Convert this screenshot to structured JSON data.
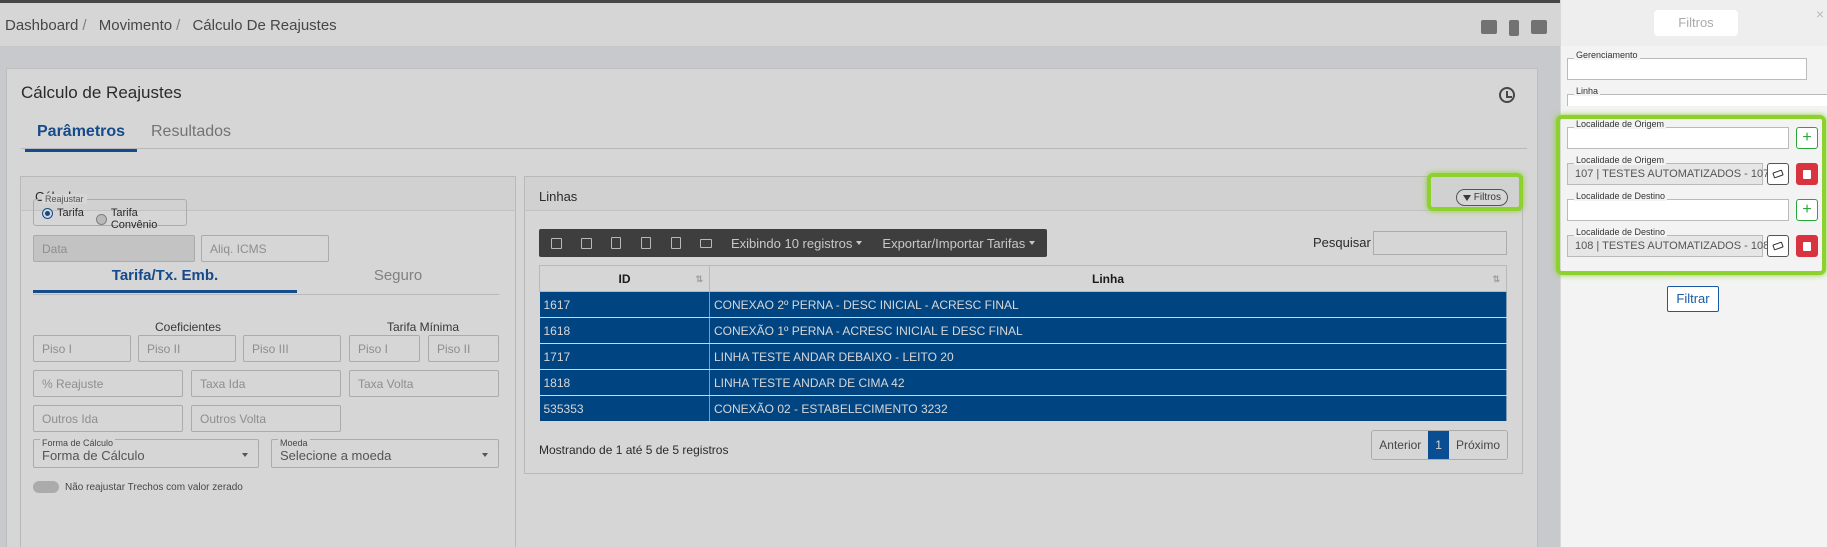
{
  "breadcrumb": [
    "Dashboard",
    "Movimento",
    "Cálculo De Reajustes"
  ],
  "page": {
    "title": "Cálculo de Reajustes",
    "tabs": [
      "Parâmetros",
      "Resultados"
    ]
  },
  "calculos": {
    "title": "Cálculos",
    "reajustar_legend": "Reajustar",
    "radio_tarifa": "Tarifa",
    "radio_tarifa_convenio": "Tarifa Convênio",
    "data_placeholder": "Data",
    "aliq_placeholder": "Aliq. ICMS",
    "subtabs": [
      "Tarifa/Tx. Emb.",
      "Seguro"
    ],
    "coeficientes_label": "Coeficientes",
    "tarifa_minima_label": "Tarifa Mínima",
    "piso_row": [
      "Piso I",
      "Piso II",
      "Piso III",
      "Piso I",
      "Piso II"
    ],
    "reajuste_placeholder": "% Reajuste",
    "taxa_ida_placeholder": "Taxa Ida",
    "taxa_volta_placeholder": "Taxa Volta",
    "outros_ida_placeholder": "Outros Ida",
    "outros_volta_placeholder": "Outros Volta",
    "forma_calculo_caption": "Forma de Cálculo",
    "forma_calculo_value": "Forma de Cálculo",
    "moeda_caption": "Moeda",
    "moeda_value": "Selecione a moeda",
    "toggle_text": "Não reajustar Trechos com valor zerado"
  },
  "linhas": {
    "title": "Linhas",
    "filtros_label": "Filtros",
    "toolbar_exibindo": "Exibindo 10 registros",
    "toolbar_exportar": "Exportar/Importar Tarifas",
    "search_label": "Pesquisar",
    "columns": [
      "ID",
      "Linha"
    ],
    "rows": [
      {
        "id": "1617",
        "linha": "CONEXAO 2º PERNA - DESC INICIAL - ACRESC FINAL"
      },
      {
        "id": "1618",
        "linha": "CONEXÃO 1º PERNA - ACRESC INICIAL E DESC FINAL"
      },
      {
        "id": "1717",
        "linha": "LINHA TESTE ANDAR DEBAIXO - LEITO 20"
      },
      {
        "id": "1818",
        "linha": "LINHA TESTE ANDAR DE CIMA 42"
      },
      {
        "id": "535353",
        "linha": "CONEXÃO 02 - ESTABELECIMENTO 3232"
      }
    ],
    "footer": "Mostrando de 1 até 5 de 5 registros",
    "pager_prev": "Anterior",
    "pager_current": "1",
    "pager_next": "Próximo"
  },
  "drawer": {
    "title": "Filtros",
    "close": "×",
    "gerenciamento": "Gerenciamento",
    "linha": "Linha",
    "origem_caption": "Localidade de Origem",
    "origem_value": "107 | TESTES AUTOMATIZADOS - 107",
    "destino_caption": "Localidade de Destino",
    "destino_value": "108 | TESTES AUTOMATIZADOS - 108",
    "filtrar": "Filtrar"
  },
  "colors": {
    "accent": "#1a5aa5",
    "row_selected": "#00529b",
    "highlight": "#8cd12e",
    "danger": "#d9333f",
    "success": "#2aa63a"
  }
}
